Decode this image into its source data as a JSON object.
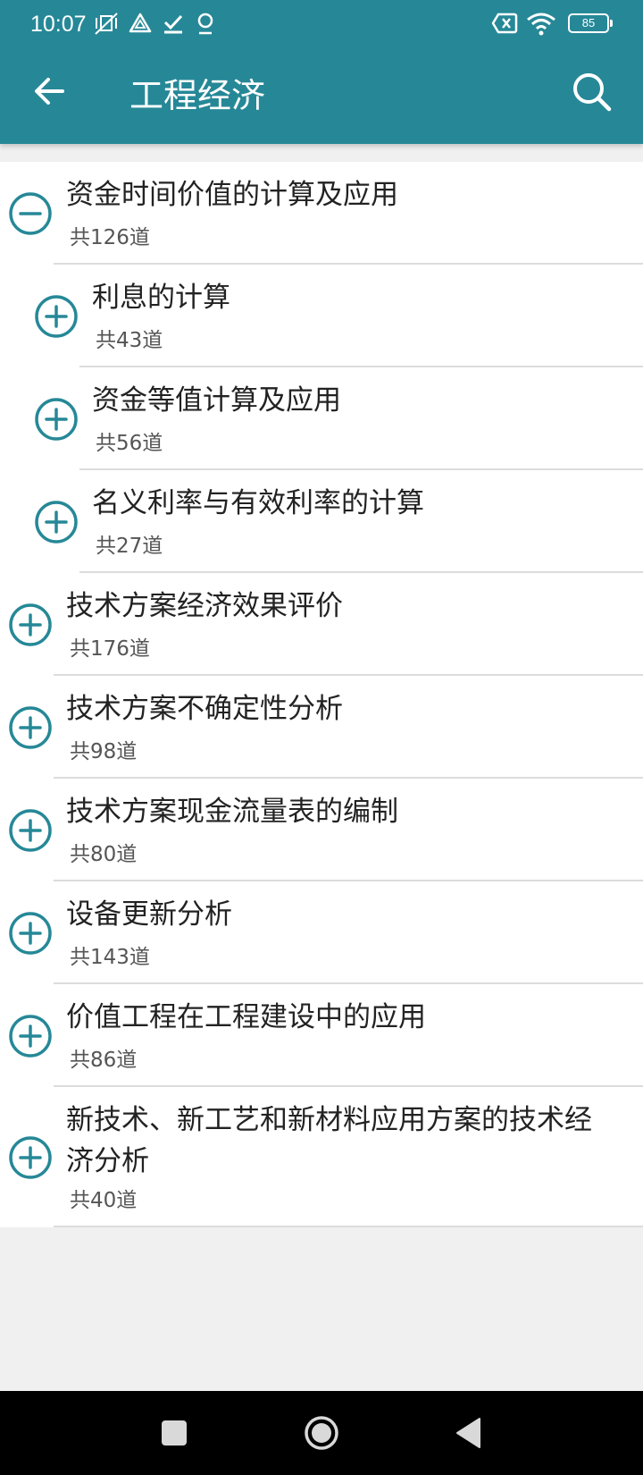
{
  "colors": {
    "brand": "#268897",
    "accent_icon": "#268897"
  },
  "status_bar": {
    "time": "10:07",
    "battery": "85",
    "left_icons": [
      "mute-vibrate-icon",
      "triangle-icon",
      "check-icon",
      "location-pin-icon"
    ],
    "right_icons": [
      "no-sim-icon",
      "wifi-icon",
      "battery-icon"
    ]
  },
  "app_bar": {
    "title": "工程经济",
    "back_icon": "arrow-left-icon",
    "search_icon": "search-icon"
  },
  "list": {
    "items": [
      {
        "title": "资金时间价值的计算及应用",
        "count": "共126道",
        "state": "expanded",
        "level": 0
      },
      {
        "title": "利息的计算",
        "count": "共43道",
        "state": "collapsed",
        "level": 1
      },
      {
        "title": "资金等值计算及应用",
        "count": "共56道",
        "state": "collapsed",
        "level": 1
      },
      {
        "title": "名义利率与有效利率的计算",
        "count": "共27道",
        "state": "collapsed",
        "level": 1
      },
      {
        "title": "技术方案经济效果评价",
        "count": "共176道",
        "state": "collapsed",
        "level": 0
      },
      {
        "title": "技术方案不确定性分析",
        "count": "共98道",
        "state": "collapsed",
        "level": 0
      },
      {
        "title": "技术方案现金流量表的编制",
        "count": "共80道",
        "state": "collapsed",
        "level": 0
      },
      {
        "title": "设备更新分析",
        "count": "共143道",
        "state": "collapsed",
        "level": 0
      },
      {
        "title": "价值工程在工程建设中的应用",
        "count": "共86道",
        "state": "collapsed",
        "level": 0
      },
      {
        "title": "新技术、新工艺和新材料应用方案的技术经济分析",
        "title_lines": [
          "新技术、新工艺和新材料应用方案的技术经",
          "济分析"
        ],
        "count": "共40道",
        "state": "collapsed",
        "level": 0
      }
    ]
  },
  "nav_bar": {
    "buttons": [
      "recent-apps-square-icon",
      "home-circle-icon",
      "back-triangle-icon"
    ]
  }
}
